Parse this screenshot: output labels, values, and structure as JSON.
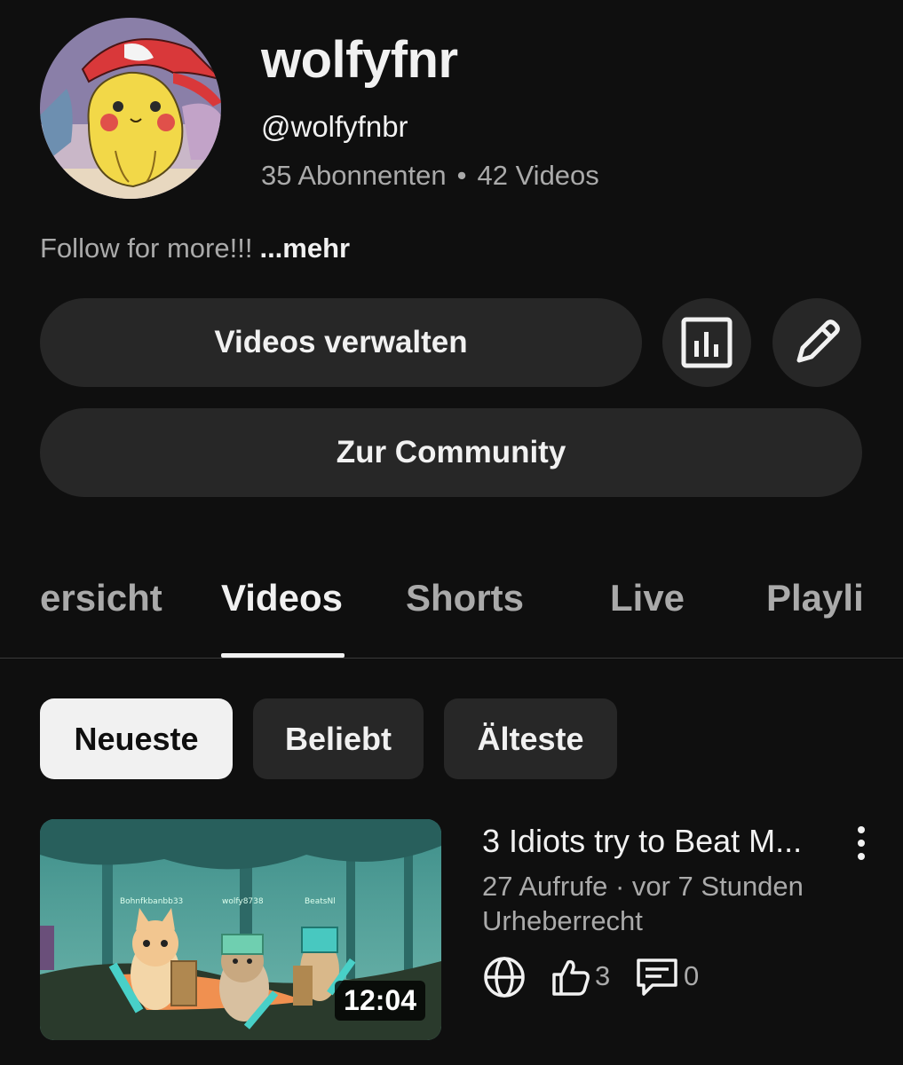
{
  "channel": {
    "name": "wolfyfnr",
    "handle": "@wolfyfnbr",
    "subscribers": "35 Abonnenten",
    "separator": "•",
    "videos": "42 Videos",
    "description": "Follow for more!!!",
    "more_label": "...mehr"
  },
  "actions": {
    "manage_videos": "Videos verwalten",
    "community": "Zur Community",
    "analytics_icon": "analytics-icon",
    "edit_icon": "pencil-icon"
  },
  "tabs": [
    {
      "label": "ersicht",
      "active": false
    },
    {
      "label": "Videos",
      "active": true
    },
    {
      "label": "Shorts",
      "active": false
    },
    {
      "label": "Live",
      "active": false
    },
    {
      "label": "Playli",
      "active": false
    }
  ],
  "filters": [
    {
      "label": "Neueste",
      "selected": true
    },
    {
      "label": "Beliebt",
      "selected": false
    },
    {
      "label": "Älteste",
      "selected": false
    }
  ],
  "video": {
    "title": "3 Idiots try to Beat M...",
    "meta": "27 Aufrufe · vor 7 Stunden",
    "rights": "Urheberrecht",
    "duration": "12:04",
    "likes": "3",
    "comments": "0",
    "thumbnail_labels": [
      "Bohnfkbanbb33",
      "wolfy8738",
      "BeatsNl"
    ]
  },
  "colors": {
    "background": "#0f0f0f",
    "button": "#272727",
    "text": "#f1f1f1",
    "secondary": "#aaaaaa"
  }
}
